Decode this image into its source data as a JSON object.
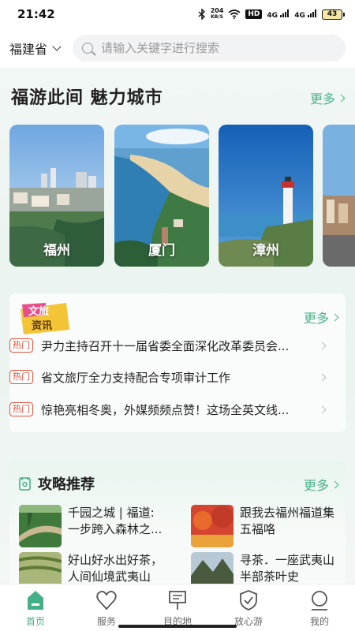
{
  "status_bar": {
    "time": "21:42",
    "net_speed_value": "204",
    "net_speed_unit": "KB/S",
    "hd_label": "HD",
    "signal1": "4G",
    "signal2": "4G",
    "battery": "43"
  },
  "header": {
    "province": "福建省",
    "search_placeholder": "请输入关键字进行搜索"
  },
  "cities_section": {
    "title": "福游此间 魅力城市",
    "more": "更多",
    "cities": [
      {
        "name": "福州"
      },
      {
        "name": "厦门"
      },
      {
        "name": "漳州"
      },
      {
        "name": ""
      }
    ]
  },
  "news_section": {
    "logo_line1": "文旅",
    "logo_line2": "资讯",
    "more": "更多",
    "hot_tag": "热门",
    "items": [
      {
        "text": "尹力主持召开十一届省委全面深化改革委员会..."
      },
      {
        "text": "省文旅厅全力支持配合专项审计工作"
      },
      {
        "text": "惊艳亮相冬奥，外媒频频点赞！这场全英文线..."
      }
    ]
  },
  "guide_section": {
    "title": "攻略推荐",
    "more": "更多",
    "items": [
      {
        "line1": "千园之城 | 福道:",
        "line2": "一步跨入森林之..."
      },
      {
        "line1": "跟我去福州福道集",
        "line2": "五福咯"
      },
      {
        "line1": "好山好水出好茶，",
        "line2": "人间仙境武夷山"
      },
      {
        "line1": "寻茶．一座武夷山",
        "line2": "半部茶叶史"
      }
    ]
  },
  "tabbar": {
    "tabs": [
      {
        "label": "首页"
      },
      {
        "label": "服务"
      },
      {
        "label": "目的地"
      },
      {
        "label": "放心游"
      },
      {
        "label": "我的"
      }
    ]
  },
  "colors": {
    "accent": "#45b087",
    "hot": "#e0533d"
  }
}
